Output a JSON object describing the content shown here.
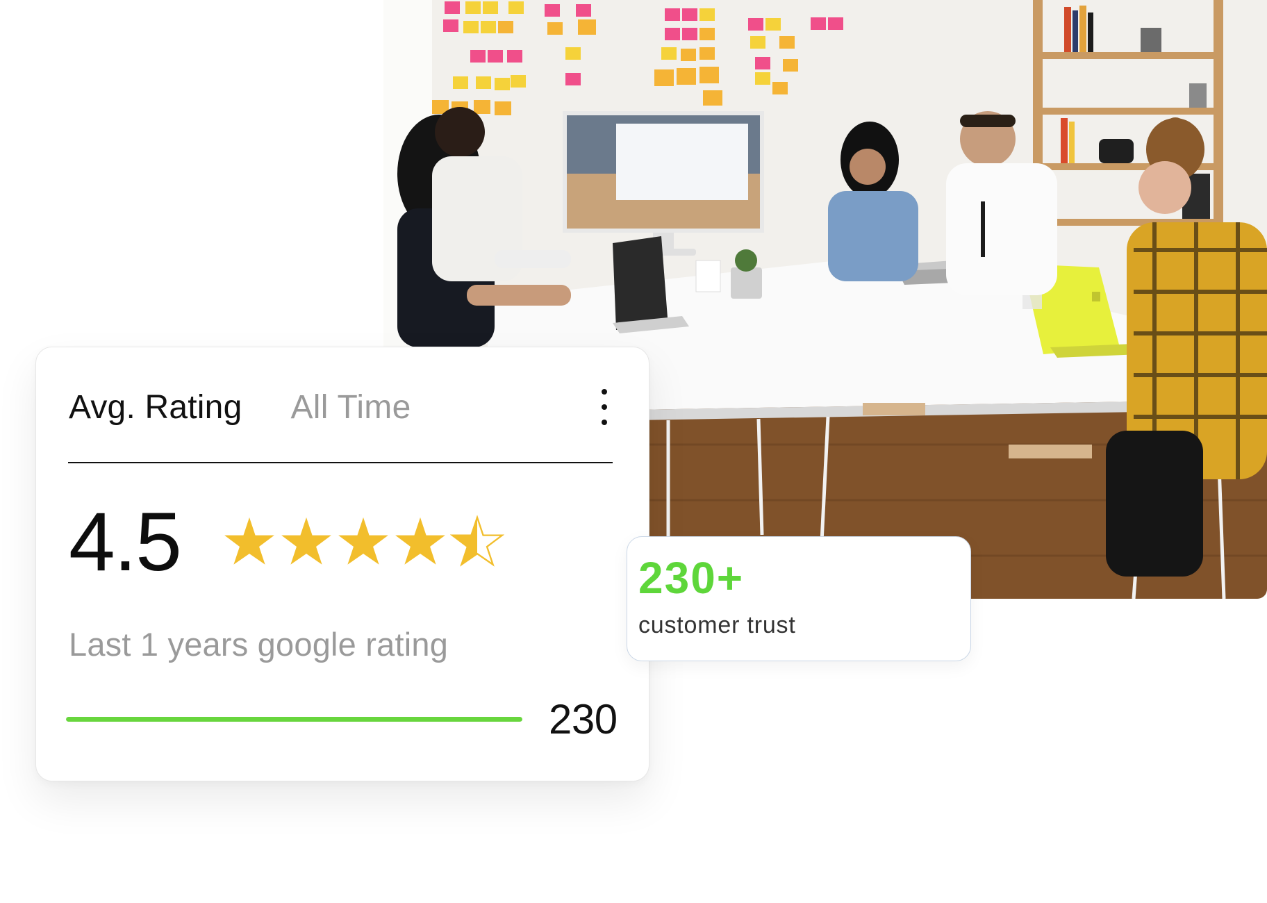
{
  "rating_card": {
    "title": "Avg. Rating",
    "period": "All Time",
    "menu_icon": "kebab-menu-icon",
    "rating": "4.5",
    "stars_filled": 4,
    "stars_half": 1,
    "star_color": "#F2BE2C",
    "caption": "Last 1 years google rating",
    "progress_fraction": 1.0,
    "progress_color": "#68D63D",
    "count": "230"
  },
  "trust_card": {
    "value": "230+",
    "label": "customer trust",
    "accent_color": "#5ED63A"
  },
  "photo": {
    "subject": "team-meeting-photo"
  }
}
